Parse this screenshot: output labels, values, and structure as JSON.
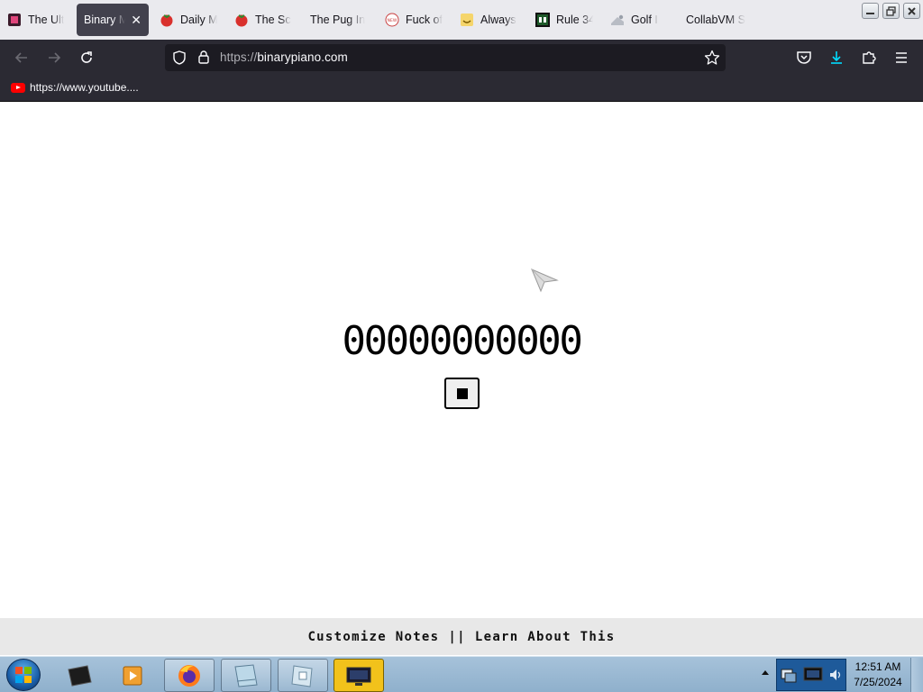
{
  "tabs": [
    {
      "title": "The Ult",
      "icon": "dark-square-favicon-icon",
      "active": false
    },
    {
      "title": "Binary M",
      "icon": "none",
      "active": true
    },
    {
      "title": "Daily M",
      "icon": "tomato-favicon-icon",
      "active": false
    },
    {
      "title": "The Sc",
      "icon": "tomato-favicon-icon",
      "active": false
    },
    {
      "title": "The Pug In",
      "icon": "none",
      "active": false
    },
    {
      "title": "Fuck of",
      "icon": "news-favicon-icon",
      "active": false
    },
    {
      "title": "Always",
      "icon": "emoji-favicon-icon",
      "active": false
    },
    {
      "title": "Rule 34",
      "icon": "rule34-favicon-icon",
      "active": false
    },
    {
      "title": "Golf I",
      "icon": "golf-favicon-icon",
      "active": false
    },
    {
      "title": "CollabVM S",
      "icon": "none",
      "active": false
    }
  ],
  "toolbar": {
    "url_scheme": "https://",
    "url_host": "binarypiano.com"
  },
  "bookmarks": [
    {
      "label": "https://www.youtube....",
      "icon": "youtube-icon"
    }
  ],
  "page": {
    "binary_display": "00000000000",
    "footer_customize": "Customize Notes",
    "footer_separator": "||",
    "footer_learn": "Learn About This"
  },
  "taskbar": {
    "clock_time": "12:51 AM",
    "clock_date": "7/25/2024"
  },
  "colors": {
    "tab_strip_bg": "#eaeaee",
    "toolbar_bg": "#2b2a33",
    "urlbar_bg": "#1c1b22",
    "download_accent": "#00ddff",
    "taskbar_active": "#f2c21b"
  }
}
